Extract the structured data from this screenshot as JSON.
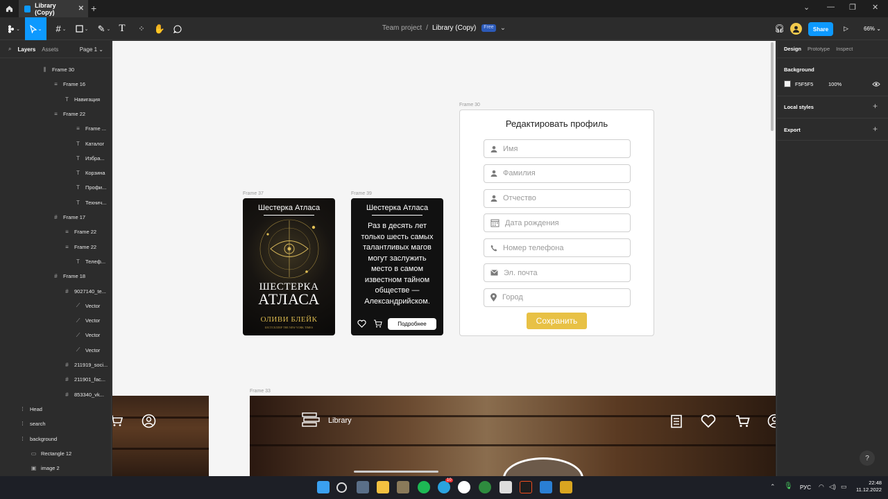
{
  "window": {
    "tab_title": "Library (Copy)"
  },
  "toolbar": {
    "breadcrumb_team": "Team project",
    "breadcrumb_sep": "/",
    "breadcrumb_file": "Library (Copy)",
    "plan_badge": "Free",
    "share_label": "Share",
    "zoom": "66%"
  },
  "left_panel": {
    "tab_layers": "Layers",
    "tab_assets": "Assets",
    "page": "Page 1",
    "layers": [
      {
        "name": "Frame 30",
        "icon": "frame-autolayout-icon"
      },
      {
        "name": "Frame 16",
        "icon": "autolayout-vertical-icon"
      },
      {
        "name": "Навигация",
        "icon": "text-icon"
      },
      {
        "name": "Frame 22",
        "icon": "autolayout-vertical-icon"
      },
      {
        "name": "Frame ...",
        "icon": "autolayout-vertical-icon"
      },
      {
        "name": "Каталог",
        "icon": "text-icon"
      },
      {
        "name": "Избра...",
        "icon": "text-icon"
      },
      {
        "name": "Корзина",
        "icon": "text-icon"
      },
      {
        "name": "Профи...",
        "icon": "text-icon"
      },
      {
        "name": "Технич...",
        "icon": "text-icon"
      },
      {
        "name": "Frame 17",
        "icon": "frame-icon"
      },
      {
        "name": "Frame 22",
        "icon": "autolayout-vertical-icon"
      },
      {
        "name": "Frame 22",
        "icon": "autolayout-vertical-icon"
      },
      {
        "name": "Телеф...",
        "icon": "text-icon"
      },
      {
        "name": "Frame 18",
        "icon": "frame-icon"
      },
      {
        "name": "9027140_te...",
        "icon": "frame-icon"
      },
      {
        "name": "Vector",
        "icon": "vector-icon"
      },
      {
        "name": "Vector",
        "icon": "vector-icon"
      },
      {
        "name": "Vector",
        "icon": "vector-icon"
      },
      {
        "name": "Vector",
        "icon": "vector-icon"
      },
      {
        "name": "211919_soci...",
        "icon": "frame-icon"
      },
      {
        "name": "211901_fac...",
        "icon": "frame-icon"
      },
      {
        "name": "853340_vk...",
        "icon": "frame-icon"
      },
      {
        "name": "Head",
        "icon": "group-icon"
      },
      {
        "name": "search",
        "icon": "group-icon"
      },
      {
        "name": "background",
        "icon": "group-icon"
      },
      {
        "name": "Rectangle 12",
        "icon": "rectangle-icon"
      },
      {
        "name": "image 2",
        "icon": "image-icon"
      }
    ]
  },
  "canvas": {
    "frame_labels": {
      "frame37": "Frame 37",
      "frame39": "Frame 39",
      "frame30": "Frame 30",
      "frame33": "Frame 33"
    },
    "book_cover": {
      "series": "Шестерка Атласа",
      "title_line1": "ШЕСТЕРКА",
      "title_line2": "АТЛАСА",
      "author": "ОЛИВИ БЛЕЙК",
      "blurb_line1": "БЕСТСЕЛЛЕР THE NEW YORK TIMES"
    },
    "book_detail": {
      "series": "Шестерка Атласа",
      "description": "Раз в десять лет только шесть самых талантливых магов могут заслужить место в самом известном тайном обществе — Александрийском.",
      "more_label": "Подробнее"
    },
    "profile_form": {
      "title": "Редактировать профиль",
      "fields": [
        {
          "placeholder": "Имя",
          "icon": "person-icon"
        },
        {
          "placeholder": "Фамилия",
          "icon": "person-icon"
        },
        {
          "placeholder": "Отчество",
          "icon": "person-icon"
        },
        {
          "placeholder": "Дата рождения",
          "icon": "calendar-icon"
        },
        {
          "placeholder": "Номер телефона",
          "icon": "phone-icon"
        },
        {
          "placeholder": "Эл. почта",
          "icon": "mail-icon"
        },
        {
          "placeholder": "Город",
          "icon": "location-pin-icon"
        }
      ],
      "save_label": "Сохранить"
    },
    "header_banner": {
      "logo_text": "Library"
    }
  },
  "right_panel": {
    "tab_design": "Design",
    "tab_prototype": "Prototype",
    "tab_inspect": "Inspect",
    "background_label": "Background",
    "bg_hex": "F5F5F5",
    "bg_opacity": "100%",
    "local_styles": "Local styles",
    "export": "Export",
    "help": "?"
  },
  "taskbar": {
    "lang": "РУС",
    "time": "22:48",
    "date": "11.12.2022",
    "badge_count": "10"
  },
  "colors": {
    "accent": "#0d99ff",
    "save": "#e8c145",
    "canvas_bg": "#F5F5F5"
  }
}
